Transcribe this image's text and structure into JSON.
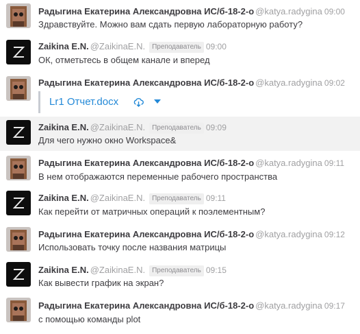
{
  "messages": [
    {
      "name": "Радыгина Екатерина Александровна ИС/б-18-2-о",
      "username": "@katya.radygina",
      "time": "09:00",
      "text": "Здравствуйте. Можно вам сдать первую лабораторную работу?",
      "avatar": "doll-avatar-icon"
    },
    {
      "name": "Zaikina E.N.",
      "username": "@ZaikinaE.N.",
      "role": "Преподаватель",
      "time": "09:00",
      "text": "ОК, отметьтесь в общем канале и вперед",
      "avatar": "z-logo-avatar-icon"
    },
    {
      "name": "Радыгина Екатерина Александровна ИС/б-18-2-о",
      "username": "@katya.radygina",
      "time": "09:02",
      "file": "Lr1 Отчет.docx",
      "avatar": "doll-avatar-icon"
    },
    {
      "name": "Zaikina E.N.",
      "username": "@ZaikinaE.N.",
      "role": "Преподаватель",
      "time": "09:09",
      "text": "Для чего нужно окно Workspace&",
      "avatar": "z-logo-avatar-icon",
      "highlighted": true
    },
    {
      "name": "Радыгина Екатерина Александровна ИС/б-18-2-о",
      "username": "@katya.radygina",
      "time": "09:11",
      "text": "В нем отображаются переменные рабочего пространства",
      "avatar": "doll-avatar-icon"
    },
    {
      "name": "Zaikina E.N.",
      "username": "@ZaikinaE.N.",
      "role": "Преподаватель",
      "time": "09:11",
      "text": "Как перейти от матричных операций к поэлементным?",
      "avatar": "z-logo-avatar-icon"
    },
    {
      "name": "Радыгина Екатерина Александровна ИС/б-18-2-о",
      "username": "@katya.radygina",
      "time": "09:12",
      "text": "Использовать точку после названия матрицы",
      "avatar": "doll-avatar-icon"
    },
    {
      "name": "Zaikina E.N.",
      "username": "@ZaikinaE.N.",
      "role": "Преподаватель",
      "time": "09:15",
      "text": "Как вывести график на экран?",
      "avatar": "z-logo-avatar-icon"
    },
    {
      "name": "Радыгина Екатерина Александровна ИС/б-18-2-о",
      "username": "@katya.radygina",
      "time": "09:17",
      "text": "с помощью команды plot",
      "avatar": "doll-avatar-icon"
    }
  ],
  "colors": {
    "link": "#2389d7",
    "highlight_row": "#f2f2f2",
    "muted": "#a0a0a2"
  }
}
